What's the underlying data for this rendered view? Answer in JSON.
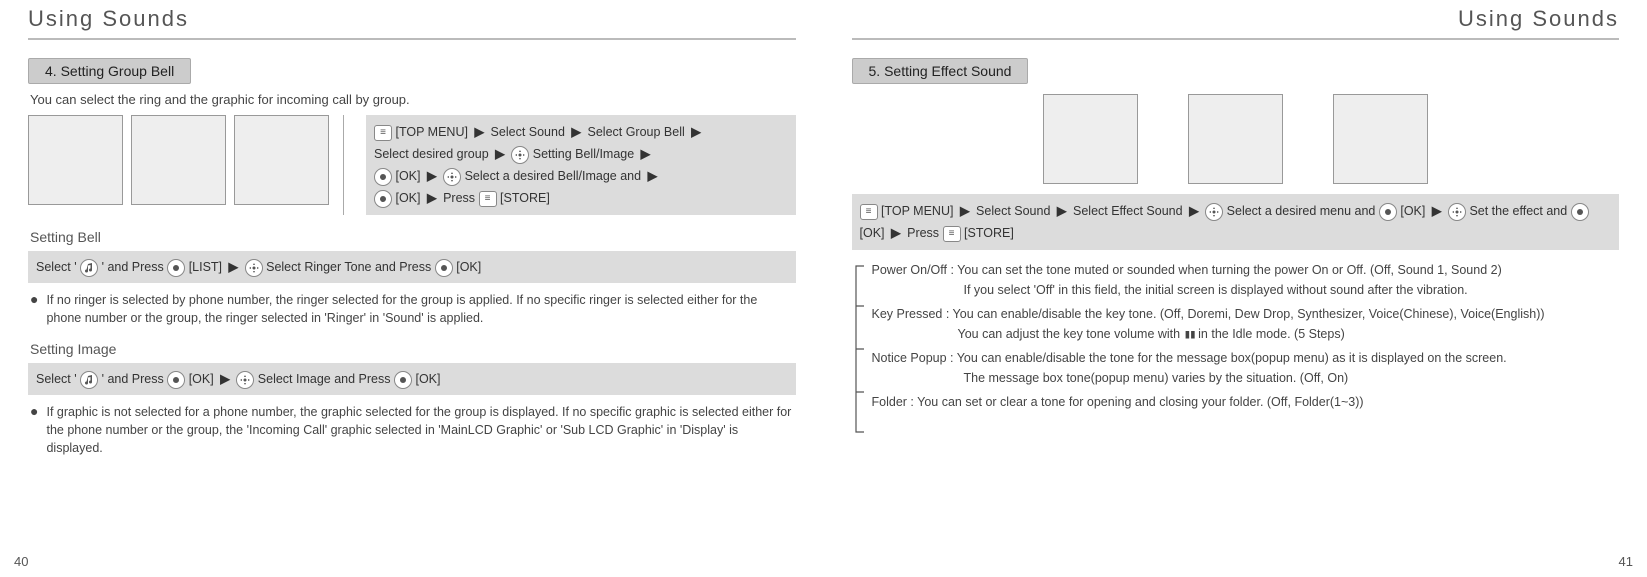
{
  "headerLeft": "Using Sounds",
  "headerRight": "Using Sounds",
  "sec4": {
    "title": "4. Setting Group Bell",
    "subtitle": "You can select the ring and the graphic for incoming call by group.",
    "steps": {
      "topMenu": "[TOP MENU]",
      "selSound": "Select Sound",
      "selGroupBell": "Select Group Bell",
      "selGroup": "Select desired group",
      "settingBI": "Setting Bell/Image",
      "ok1": "[OK]",
      "selDesired": "Select a desired Bell/Image and",
      "ok2": "[OK]",
      "press": "Press",
      "store": "[STORE]"
    },
    "bellHeading": "Setting Bell",
    "bell": {
      "selectWord": "Select '",
      "andPress": "' and Press",
      "list": "[LIST]",
      "selRinger": "Select Ringer Tone and Press",
      "ok": "[OK]"
    },
    "bellNote": "If no ringer is selected by phone number, the ringer selected for the group is applied. If no specific ringer is selected either for the phone number or the group, the ringer selected in 'Ringer' in 'Sound' is applied.",
    "imageHeading": "Setting Image",
    "image": {
      "selectWord": "Select '",
      "andPress": "' and Press",
      "ok1": "[OK]",
      "selImg": "Select Image and Press",
      "ok2": "[OK]"
    },
    "imageNote": "If graphic is not selected for a phone number, the graphic selected for the group is displayed. If no specific graphic is selected either for the phone number or the group, the 'Incoming Call' graphic selected in 'MainLCD Graphic' or 'Sub LCD Graphic' in 'Display' is displayed."
  },
  "sec5": {
    "title": "5. Setting Effect Sound",
    "steps": {
      "topMenu": "[TOP MENU]",
      "selSound": "Select Sound",
      "selEffect": "Select Effect Sound",
      "selMenu": "Select a desired menu and",
      "ok1": "[OK]",
      "setEffect": "Set the effect and",
      "ok2": "[OK]",
      "press": "Press",
      "store": "[STORE]"
    },
    "items": {
      "power1": "Power On/Off : You can set the tone muted or sounded when turning the power On or Off. (Off, Sound 1, Sound 2)",
      "power2": "If you select 'Off' in this field, the initial screen is displayed without sound after the vibration.",
      "key1": "Key Pressed : You can enable/disable the key tone. (Off, Doremi, Dew Drop, Synthesizer, Voice(Chinese), Voice(English))",
      "key2a": "You can adjust the key tone volume with",
      "key2b": "in the Idle mode. (5 Steps)",
      "notice1": "Notice Popup : You can enable/disable the tone for the message box(popup menu) as it is displayed on the screen.",
      "notice2": "The message box tone(popup menu) varies by the situation. (Off, On)",
      "folder": "Folder : You can set or clear a tone for opening and closing your folder. (Off, Folder(1~3))"
    }
  },
  "pageLeft": "40",
  "pageRight": "41"
}
